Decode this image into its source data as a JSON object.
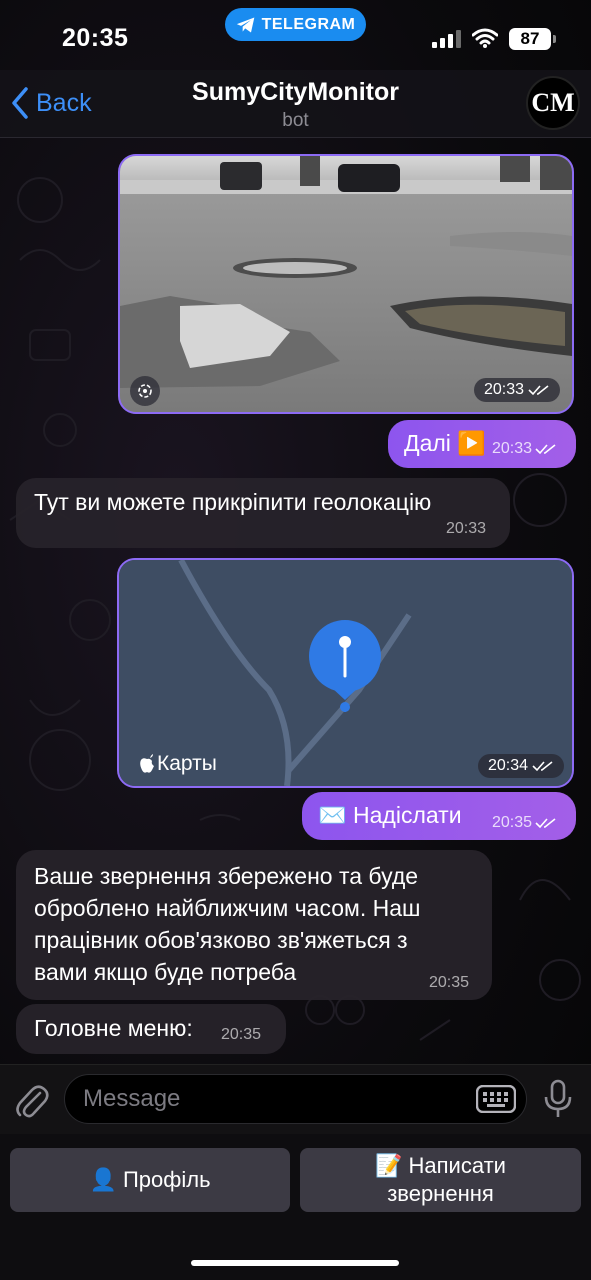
{
  "status_bar": {
    "time": "20:35",
    "app_pill": "TELEGRAM",
    "battery": "87"
  },
  "header": {
    "back_label": "Back",
    "title": "SumyCityMonitor",
    "subtitle": "bot",
    "avatar_text": "CM"
  },
  "messages": {
    "photo": {
      "time": "20:33"
    },
    "next": {
      "text": "Далі ▶️",
      "time": "20:33"
    },
    "geo_prompt": {
      "text": "Тут ви можете прикріпити геолокацію",
      "time": "20:33"
    },
    "map": {
      "brand": "Карты",
      "time": "20:34"
    },
    "send": {
      "text": "✉️ Надіслати",
      "time": "20:35"
    },
    "saved": {
      "lines": [
        "Ваше звернення збережено та буде",
        "оброблено найближчим часом. Наш",
        "працівник обов'язково зв'яжеться з",
        "вами якщо буде потреба"
      ],
      "time": "20:35"
    },
    "menu": {
      "text": "Головне меню:",
      "time": "20:35"
    }
  },
  "composer": {
    "placeholder": "Message"
  },
  "keyboard": {
    "profile": "👤 Профіль",
    "write_line1": "📝 Написати",
    "write_line2": "звернення"
  },
  "colors": {
    "accent": "#3d8ff7",
    "outgoing_bubble": "#9a5aeb",
    "incoming_bubble": "#26222a",
    "telegram_pill": "#1a8cf0"
  }
}
